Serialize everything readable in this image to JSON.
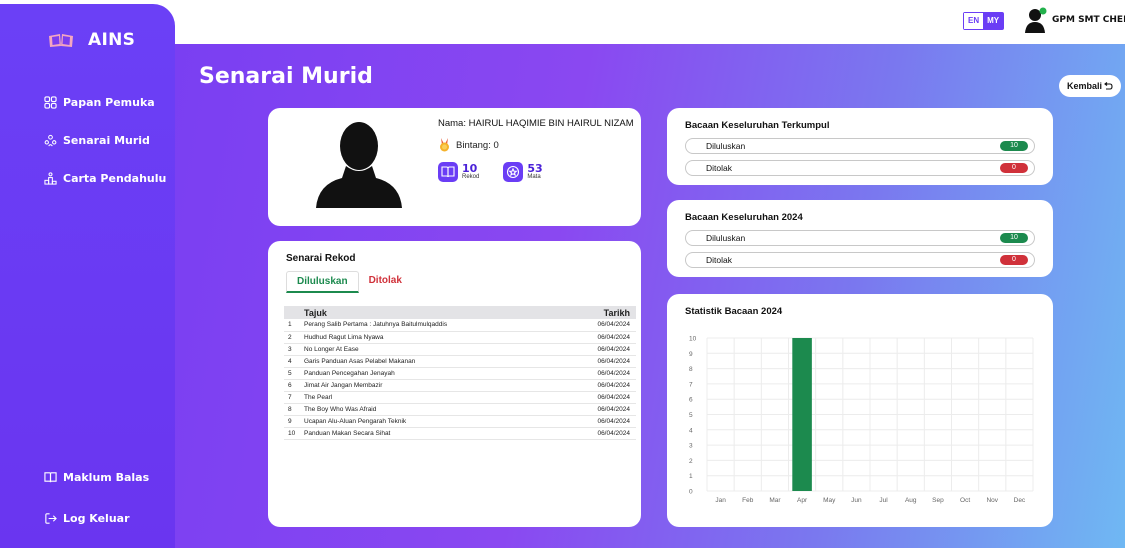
{
  "app": {
    "name": "AINS"
  },
  "sidebar": {
    "items": [
      {
        "label": "Papan Pemuka",
        "icon": "grid-icon"
      },
      {
        "label": "Senarai Murid",
        "icon": "users-icon"
      },
      {
        "label": "Carta Pendahulu",
        "icon": "podium-icon"
      }
    ],
    "bottom": [
      {
        "label": "Maklum Balas",
        "icon": "book-icon"
      },
      {
        "label": "Log Keluar",
        "icon": "logout-icon"
      }
    ]
  },
  "header": {
    "lang": {
      "en": "EN",
      "my": "MY"
    },
    "user_name": "GPM SMT CHERA"
  },
  "page": {
    "title": "Senarai Murid",
    "back_label": "Kembali"
  },
  "profile": {
    "name": "Nama: HAIRUL HAQIMIE BIN HAIRUL NIZAM",
    "bintang": "Bintang: 0",
    "rekod": {
      "value": "10",
      "label": "Rekod"
    },
    "mata": {
      "value": "53",
      "label": "Mata"
    }
  },
  "rekod": {
    "title": "Senarai Rekod",
    "tabs": [
      "Diluluskan",
      "Ditolak"
    ],
    "headers": {
      "tajuk": "Tajuk",
      "tarikh": "Tarikh"
    },
    "rows": [
      {
        "no": "1",
        "tajuk": "Perang Salib Pertama : Jatuhnya Baitulmulqaddis",
        "tarikh": "06/04/2024"
      },
      {
        "no": "2",
        "tajuk": "Hudhud Ragut Lima Nyawa",
        "tarikh": "06/04/2024"
      },
      {
        "no": "3",
        "tajuk": "No Longer At Ease",
        "tarikh": "06/04/2024"
      },
      {
        "no": "4",
        "tajuk": "Garis Panduan Asas Pelabel Makanan",
        "tarikh": "06/04/2024"
      },
      {
        "no": "5",
        "tajuk": "Panduan Pencegahan Jenayah",
        "tarikh": "06/04/2024"
      },
      {
        "no": "6",
        "tajuk": "Jimat Air Jangan Membazir",
        "tarikh": "06/04/2024"
      },
      {
        "no": "7",
        "tajuk": "The Pearl",
        "tarikh": "06/04/2024"
      },
      {
        "no": "8",
        "tajuk": "The Boy Who Was Afraid",
        "tarikh": "06/04/2024"
      },
      {
        "no": "9",
        "tajuk": "Ucapan Alu-Aluan Pengarah Teknik",
        "tarikh": "06/04/2024"
      },
      {
        "no": "10",
        "tajuk": "Panduan Makan Secara Sihat",
        "tarikh": "06/04/2024"
      }
    ]
  },
  "keseluruhan": {
    "title": "Bacaan Keseluruhan Terkumpul",
    "diluluskan_label": "Diluluskan",
    "diluluskan": "10",
    "ditolak_label": "Ditolak",
    "ditolak": "0"
  },
  "tahunan": {
    "title": "Bacaan Keseluruhan 2024",
    "diluluskan_label": "Diluluskan",
    "diluluskan": "10",
    "ditolak_label": "Ditolak",
    "ditolak": "0"
  },
  "colors": {
    "primary": "#6a3df5",
    "approved": "#1c8a4e",
    "rejected": "#d0313a"
  },
  "chart_data": {
    "type": "bar",
    "title": "Statistik Bacaan 2024",
    "categories": [
      "Jan",
      "Feb",
      "Mar",
      "Apr",
      "May",
      "Jun",
      "Jul",
      "Aug",
      "Sep",
      "Oct",
      "Nov",
      "Dec"
    ],
    "values": [
      0,
      0,
      0,
      10,
      0,
      0,
      0,
      0,
      0,
      0,
      0,
      0
    ],
    "ylim": [
      0,
      10
    ],
    "yticks": [
      0,
      1,
      2,
      3,
      4,
      5,
      6,
      7,
      8,
      9,
      10
    ],
    "grid": true,
    "color": "#1c8a4e"
  }
}
